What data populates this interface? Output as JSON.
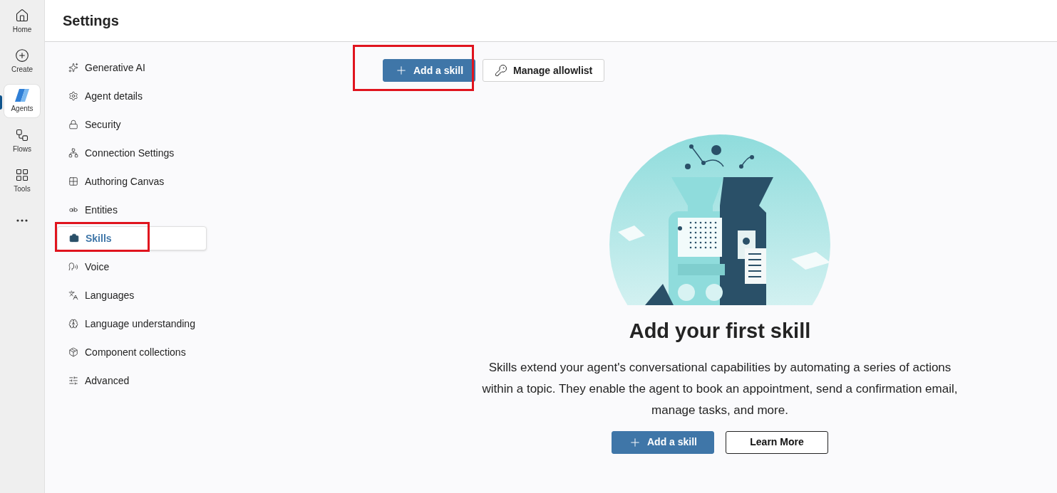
{
  "rail": [
    {
      "kind": "home",
      "label": "Home",
      "selected": false
    },
    {
      "kind": "create",
      "label": "Create",
      "selected": false
    },
    {
      "kind": "agents",
      "label": "Agents",
      "selected": true
    },
    {
      "kind": "flows",
      "label": "Flows",
      "selected": false
    },
    {
      "kind": "tools",
      "label": "Tools",
      "selected": false
    },
    {
      "kind": "more",
      "selected": false
    }
  ],
  "header": {
    "title": "Settings"
  },
  "nav": [
    {
      "kind": "sparkle",
      "label": "Generative AI",
      "selected": false,
      "highlighted": false
    },
    {
      "kind": "gear",
      "label": "Agent details",
      "selected": false,
      "highlighted": false
    },
    {
      "kind": "lock",
      "label": "Security",
      "selected": false,
      "highlighted": false
    },
    {
      "kind": "network",
      "label": "Connection Settings",
      "selected": false,
      "highlighted": false
    },
    {
      "kind": "grid",
      "label": "Authoring Canvas",
      "selected": false,
      "highlighted": false
    },
    {
      "kind": "text",
      "label": "Entities",
      "selected": false,
      "highlighted": false
    },
    {
      "kind": "briefcase",
      "label": "Skills",
      "selected": true,
      "highlighted": true
    },
    {
      "kind": "voice",
      "label": "Voice",
      "selected": false,
      "highlighted": false
    },
    {
      "kind": "languages",
      "label": "Languages",
      "selected": false,
      "highlighted": false
    },
    {
      "kind": "brain",
      "label": "Language understanding",
      "selected": false,
      "highlighted": false
    },
    {
      "kind": "box",
      "label": "Component collections",
      "selected": false,
      "highlighted": false
    },
    {
      "kind": "sliders",
      "label": "Advanced",
      "selected": false,
      "highlighted": false
    }
  ],
  "toolbar": [
    {
      "kind": "add",
      "label": "Add a skill",
      "highlighted": true
    },
    {
      "kind": "allowlist",
      "label": "Manage allowlist",
      "highlighted": false
    }
  ],
  "empty_state": {
    "title": "Add your first skill",
    "description": "Skills extend your agent's conversational capabilities by automating a series of actions within a topic. They enable the agent to book an appointment, send a confirmation email, manage tasks, and more.",
    "buttons": [
      {
        "kind": "add",
        "label": "Add a skill"
      },
      {
        "kind": "learn",
        "label": "Learn More"
      }
    ]
  }
}
